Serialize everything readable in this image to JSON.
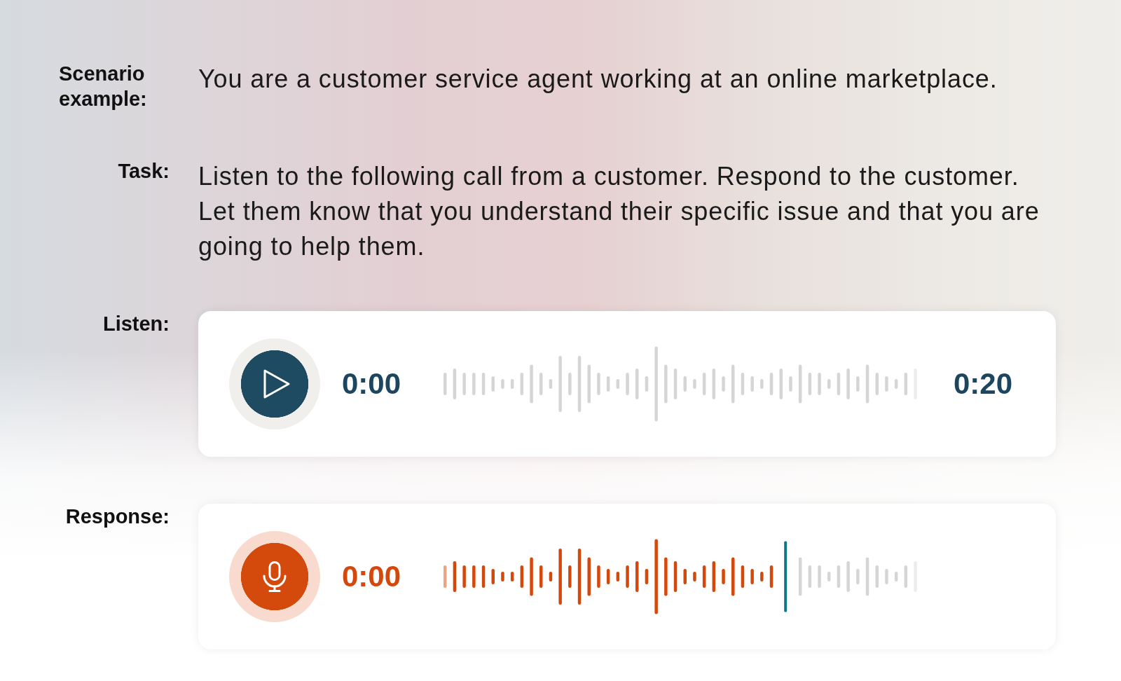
{
  "prompt_rows": [
    {
      "label": "Scenario example:",
      "text": "You are a customer service agent working at an online marketplace."
    },
    {
      "label": "Task:",
      "text": "Listen to the following call from a customer. Respond to the customer. Let them know that you understand their specific issue and that you are going to help them."
    }
  ],
  "listen": {
    "label": "Listen:",
    "elapsed": "0:00",
    "duration": "0:20"
  },
  "response": {
    "label": "Response:",
    "elapsed": "0:00",
    "level": 0.72
  }
}
